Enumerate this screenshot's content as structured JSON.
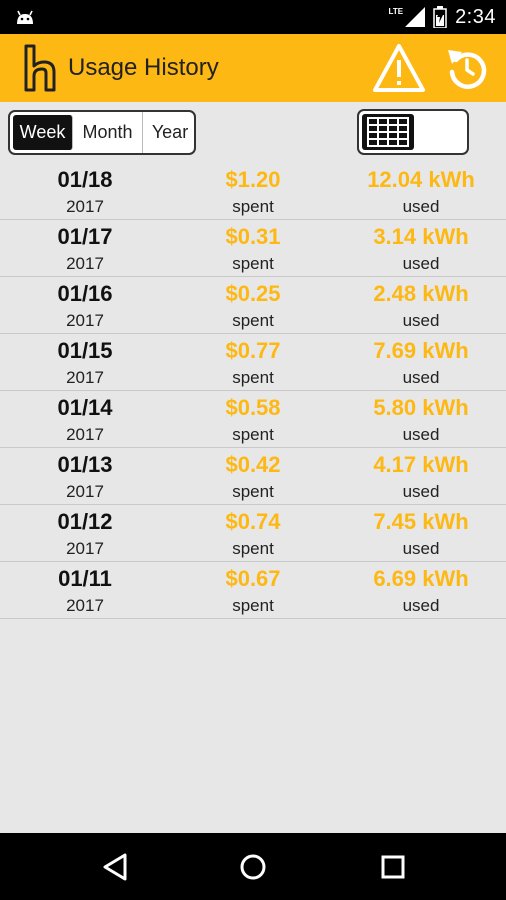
{
  "status_bar": {
    "time": "2:34",
    "network": "LTE",
    "icons": [
      "android-debug-icon",
      "signal-icon",
      "battery-icon"
    ]
  },
  "app_bar": {
    "title": "Usage History",
    "logo": "h",
    "actions": [
      "warning-icon",
      "refresh-icon"
    ],
    "background_color": "#fdb813"
  },
  "period_selector": {
    "options": [
      "Week",
      "Month",
      "Year"
    ],
    "selected": "Week"
  },
  "view_toggle": {
    "selected": "table-view",
    "icon": "grid-icon"
  },
  "accent_color": "#fdb813",
  "rows": [
    {
      "date": "01/18",
      "year": "2017",
      "cost": "$1.20",
      "spent_label": "spent",
      "kwh": "12.04 kWh",
      "used_label": "used"
    },
    {
      "date": "01/17",
      "year": "2017",
      "cost": "$0.31",
      "spent_label": "spent",
      "kwh": "3.14 kWh",
      "used_label": "used"
    },
    {
      "date": "01/16",
      "year": "2017",
      "cost": "$0.25",
      "spent_label": "spent",
      "kwh": "2.48 kWh",
      "used_label": "used"
    },
    {
      "date": "01/15",
      "year": "2017",
      "cost": "$0.77",
      "spent_label": "spent",
      "kwh": "7.69 kWh",
      "used_label": "used"
    },
    {
      "date": "01/14",
      "year": "2017",
      "cost": "$0.58",
      "spent_label": "spent",
      "kwh": "5.80 kWh",
      "used_label": "used"
    },
    {
      "date": "01/13",
      "year": "2017",
      "cost": "$0.42",
      "spent_label": "spent",
      "kwh": "4.17 kWh",
      "used_label": "used"
    },
    {
      "date": "01/12",
      "year": "2017",
      "cost": "$0.74",
      "spent_label": "spent",
      "kwh": "7.45 kWh",
      "used_label": "used"
    },
    {
      "date": "01/11",
      "year": "2017",
      "cost": "$0.67",
      "spent_label": "spent",
      "kwh": "6.69 kWh",
      "used_label": "used"
    }
  ],
  "nav_bar": {
    "buttons": [
      "back-icon",
      "home-icon",
      "recents-icon"
    ]
  }
}
